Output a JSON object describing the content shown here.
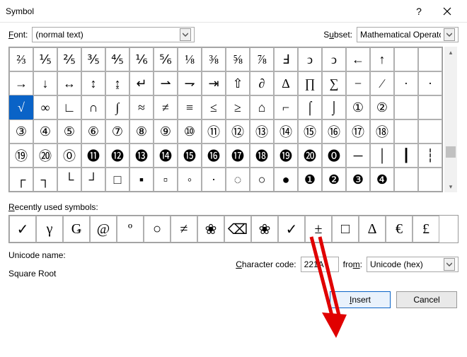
{
  "titlebar": {
    "title": "Symbol",
    "help": "?",
    "close": "×"
  },
  "font": {
    "label": "Font:",
    "value": "(normal text)"
  },
  "subset": {
    "label": "Subset:",
    "value": "Mathematical Operators"
  },
  "grid": {
    "rows": [
      [
        "⅔",
        "⅕",
        "⅖",
        "⅗",
        "⅘",
        "⅙",
        "⅚",
        "⅛",
        "⅜",
        "⅝",
        "⅞",
        "Ⅎ",
        "ↄ",
        "ↄ",
        "←",
        "↑"
      ],
      [
        "→",
        "↓",
        "↔",
        "↕",
        "↨",
        "∂",
        "∆",
        "∏",
        "∑",
        "−",
        "∕",
        "∙"
      ],
      [
        "√",
        "∞",
        "∟",
        "∩",
        "∫",
        "≈",
        "≠",
        "≡",
        "≤",
        "≥",
        "⌂",
        "⌐",
        "⌠",
        "⌡",
        "①",
        "②"
      ],
      [
        "③",
        "④",
        "⑤",
        "⑥",
        "⑦",
        "⑧",
        "⑨",
        "⑩",
        "⑪",
        "⑫",
        "⑬",
        "⑭",
        "⑮",
        "⑯",
        "⑰",
        "⑱"
      ],
      [
        "⑲",
        "⑳",
        "⓪",
        "⓫",
        "⓬",
        "⓭",
        "⓮",
        "⓯",
        "⓰",
        "⓱",
        "⓲",
        "⓳",
        "⓴",
        "⓿",
        "│"
      ],
      [
        "┌",
        "┐",
        "└",
        "┘",
        "▫",
        "▪",
        "▫",
        "◦",
        "•",
        "◦",
        "•",
        "◦",
        "❶",
        "❷",
        "❸",
        "❹"
      ]
    ],
    "row2_pad": [
      "↔",
      "↕",
      "↨",
      "↨"
    ],
    "row5_extra": "│",
    "selected": {
      "r": 2,
      "c": 0
    }
  },
  "recent": {
    "label": "Recently used symbols:",
    "items": [
      "✓",
      "γ",
      "Ǥ",
      "@",
      "º",
      "○",
      "≠",
      "❀",
      "⌫",
      "❀",
      "✓",
      "±",
      "□",
      "Δ",
      "€",
      "£"
    ]
  },
  "unicode_name": {
    "label": "Unicode name:",
    "value": "Square Root"
  },
  "charcode": {
    "label": "Character code:",
    "value": "221A"
  },
  "from": {
    "label": "from:",
    "value": "Unicode (hex)"
  },
  "buttons": {
    "insert": "Insert",
    "cancel": "Cancel"
  }
}
